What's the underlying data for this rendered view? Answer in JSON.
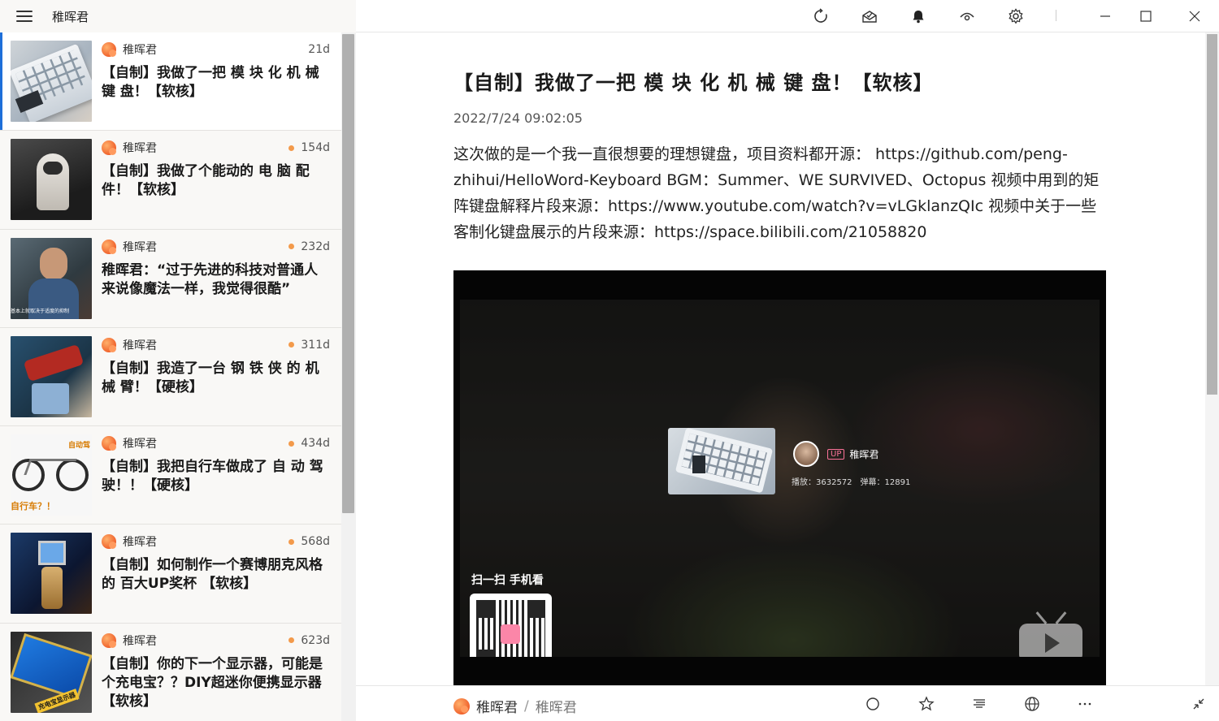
{
  "app": {
    "title": "稚晖君"
  },
  "feed": {
    "items": [
      {
        "author": "稚晖君",
        "age": "21d",
        "unread": false,
        "selected": true,
        "title": "【自制】我做了一把 模 块 化 机 械 键 盘！【软核】"
      },
      {
        "author": "稚晖君",
        "age": "154d",
        "unread": true,
        "selected": false,
        "title": "【自制】我做了个能动的 电 脑 配 件！【软核】"
      },
      {
        "author": "稚晖君",
        "age": "232d",
        "unread": true,
        "selected": false,
        "title": "稚晖君：“过于先进的科技对普通人来说像魔法一样，我觉得很酷”"
      },
      {
        "author": "稚晖君",
        "age": "311d",
        "unread": true,
        "selected": false,
        "title": "【自制】我造了一台 钢 铁 侠 的 机 械 臂！【硬核】"
      },
      {
        "author": "稚晖君",
        "age": "434d",
        "unread": true,
        "selected": false,
        "title": "【自制】我把自行车做成了 自 动 驾 驶！！【硬核】"
      },
      {
        "author": "稚晖君",
        "age": "568d",
        "unread": true,
        "selected": false,
        "title": "【自制】如何制作一个赛博朋克风格的 百大UP奖杯 【软核】"
      },
      {
        "author": "稚晖君",
        "age": "623d",
        "unread": true,
        "selected": false,
        "title": "【自制】你的下一个显示器，可能是个充电宝？？DIY超迷你便携显示器【软核】"
      }
    ],
    "thumb_captions": {
      "item3": "基本上就取决于适度的抑制",
      "item5_label": "自行车？！",
      "item5_tag": "自动驾",
      "item7_label": "充电宝显示器"
    }
  },
  "toolbar": {
    "icons": [
      "refresh-icon",
      "mark-all-read-icon",
      "notification-icon",
      "view-icon",
      "settings-icon"
    ],
    "window_controls": [
      "minimize",
      "maximize",
      "close"
    ]
  },
  "article": {
    "title": "【自制】我做了一把 模 块 化 机 械 键 盘！【软核】",
    "date": "2022/7/24 09:02:05",
    "body": "这次做的是一个我一直很想要的理想键盘，项目资料都开源： https://github.com/peng-zhihui/HelloWord-Keyboard BGM：Summer、WE SURVIVED、Octopus 视频中用到的矩阵键盘解释片段来源：https://www.youtube.com/watch?v=vLGklanzQIc 视频中关于一些客制化键盘展示的片段来源：https://space.bilibili.com/21058820"
  },
  "video": {
    "up_badge": "UP",
    "up_name": "稚晖君",
    "stats": "播放：3632572　弹幕：12891",
    "scan_text": "扫一扫 手机看"
  },
  "bottombar": {
    "source": "稚晖君",
    "sub": "稚晖君",
    "icons": [
      "mark-read-icon",
      "star-icon",
      "reader-view-icon",
      "browser-icon",
      "more-icon"
    ]
  },
  "colors": {
    "accent": "#1e6fd9",
    "unread": "#f39a4b",
    "bili_pink": "#fb7299"
  }
}
